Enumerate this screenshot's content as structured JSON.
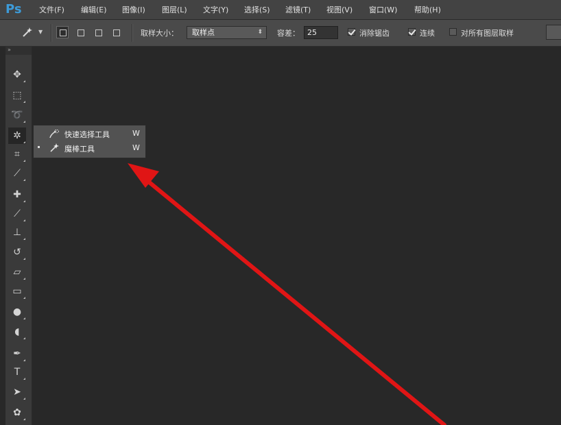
{
  "app": {
    "logo": "Ps"
  },
  "menu": [
    "文件(F)",
    "编辑(E)",
    "图像(I)",
    "图层(L)",
    "文字(Y)",
    "选择(S)",
    "滤镜(T)",
    "视图(V)",
    "窗口(W)",
    "帮助(H)"
  ],
  "options": {
    "sample_size_label": "取样大小：",
    "sample_size_value": "取样点",
    "tolerance_label": "容差：",
    "tolerance_value": "25",
    "antialias_label": "消除锯齿",
    "antialias_checked": true,
    "contiguous_label": "连续",
    "contiguous_checked": true,
    "all_layers_label": "对所有图层取样",
    "all_layers_checked": false
  },
  "flyout": {
    "items": [
      {
        "label": "快速选择工具",
        "shortcut": "W",
        "icon": "quick-selection-icon",
        "selected": false
      },
      {
        "label": "魔棒工具",
        "shortcut": "W",
        "icon": "magic-wand-icon",
        "selected": true
      }
    ]
  },
  "tools": [
    "move-icon",
    "marquee-icon",
    "lasso-icon",
    "magic-wand-icon",
    "crop-icon",
    "eyedropper-icon",
    "healing-brush-icon",
    "brush-icon",
    "clone-stamp-icon",
    "history-brush-icon",
    "eraser-icon",
    "gradient-icon",
    "blur-icon",
    "dodge-icon",
    "pen-icon",
    "type-icon",
    "path-selection-icon",
    "shape-icon"
  ],
  "colors": {
    "accent": "#3d9bd8",
    "annotation_arrow": "#e01515",
    "canvas_bg": "#282828"
  }
}
